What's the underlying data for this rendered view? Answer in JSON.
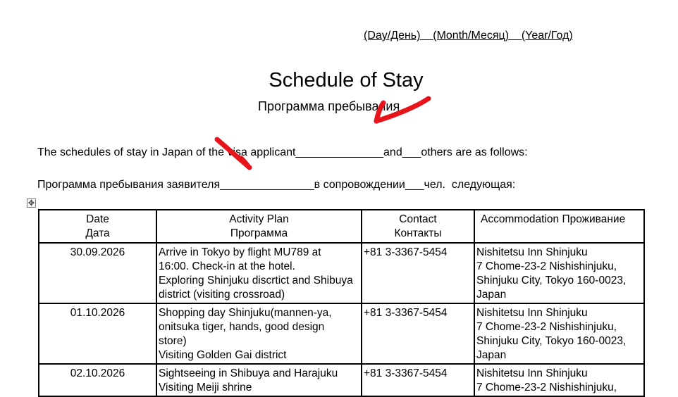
{
  "date_line": "(Day/День)    (Month/Месяц)    (Year/Год)",
  "title": "Schedule of Stay",
  "subtitle": "Программа пребывания",
  "para_en": "The schedules of stay in Japan of the visa applicant______________and___others are as follows:",
  "para_ru": "Программа пребывания заявителя_______________в сопровождении___чел.  следующая:",
  "move_handle_icon": "move-cross-icon",
  "table": {
    "headers": {
      "date_en": "Date",
      "date_ru": "Дата",
      "activity_en": "Activity Plan",
      "activity_ru": "Программа",
      "contact_en": "Contact",
      "contact_ru": "Контакты",
      "accommodation": "Accommodation Проживание"
    },
    "rows": [
      {
        "date": "30.09.2026",
        "activity": [
          "Arrive in Tokyo by flight MU789 at",
          "16:00. Check-in at the hotel.",
          "Exploring Shinjuku discrtict and Shibuya",
          "district (visiting crossroad)"
        ],
        "contact": "+81 3-3367-5454",
        "accommodation": [
          "Nishitetsu Inn Shinjuku",
          "7 Chome-23-2 Nishishinjuku,",
          "Shinjuku City, Tokyo 160-0023,",
          "Japan"
        ]
      },
      {
        "date": "01.10.2026",
        "activity": [
          "Shopping day Shinjuku(mannen-ya,",
          "onitsuka tiger, hands, good design",
          "store)",
          "Visiting Golden Gai district"
        ],
        "contact": "+81 3-3367-5454",
        "accommodation": [
          "Nishitetsu Inn Shinjuku",
          "7 Chome-23-2 Nishishinjuku,",
          "Shinjuku City, Tokyo 160-0023,",
          "Japan"
        ]
      },
      {
        "date": "02.10.2026",
        "activity": [
          "Sightseeing in Shibuya and Harajuku",
          "Visiting Meiji shrine"
        ],
        "contact": "+81 3-3367-5454",
        "accommodation": [
          "Nishitetsu Inn Shinjuku",
          "7 Chome-23-2 Nishishinjuku,"
        ]
      }
    ]
  },
  "colors": {
    "annotation_red": "#e8141c",
    "spell_red": "#dd1111",
    "grammar_blue": "#2b56c6"
  }
}
